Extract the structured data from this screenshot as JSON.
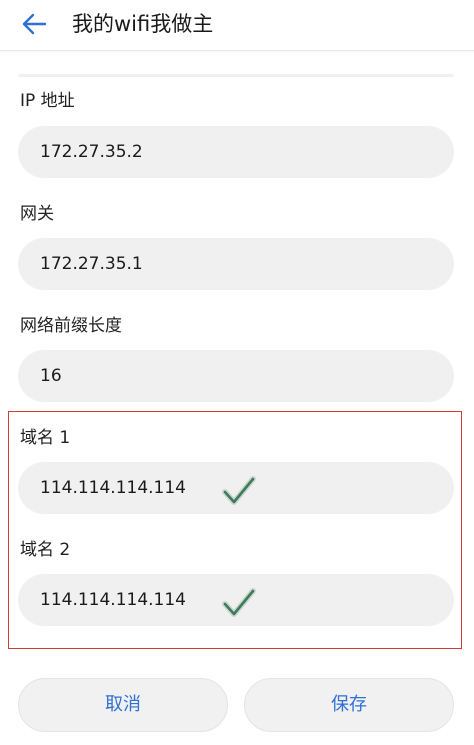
{
  "header": {
    "title": "我的wifi我做主",
    "back_icon": "arrow-left-icon"
  },
  "fields": {
    "ip": {
      "label": "IP 地址",
      "value": "172.27.35.2"
    },
    "gateway": {
      "label": "网关",
      "value": "172.27.35.1"
    },
    "prefix": {
      "label": "网络前缀长度",
      "value": "16"
    },
    "dns1": {
      "label": "域名 1",
      "value": "114.114.114.114"
    },
    "dns2": {
      "label": "域名 2",
      "value": "114.114.114.114"
    }
  },
  "buttons": {
    "cancel": "取消",
    "save": "保存"
  },
  "colors": {
    "accent": "#2f6fd6",
    "highlight": "#d43c3c",
    "check": "#3f7a5a"
  }
}
